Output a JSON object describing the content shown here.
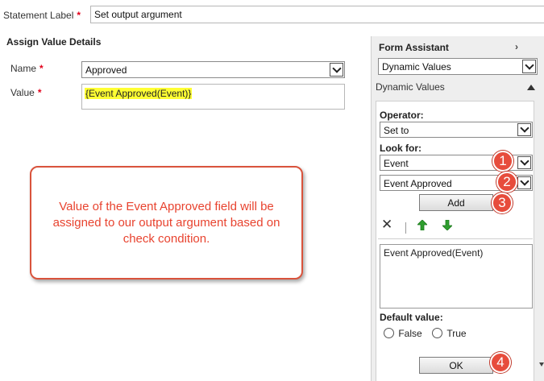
{
  "statement": {
    "label": "Statement Label",
    "value": "Set output argument"
  },
  "assign": {
    "title": "Assign Value Details",
    "name_label": "Name",
    "name_value": "Approved",
    "value_label": "Value",
    "value_text": "{Event Approved(Event)}"
  },
  "callout": {
    "text": "Value of the Event Approved field will be assigned to our output argument based on check condition."
  },
  "form_assistant": {
    "title": "Form Assistant",
    "dropdown_value": "Dynamic Values",
    "section_label": "Dynamic Values",
    "operator_label": "Operator:",
    "operator_value": "Set to",
    "look_for_label": "Look for:",
    "look_for_value": "Event",
    "field_value": "Event Approved",
    "add_label": "Add",
    "list_item": "Event Approved(Event)",
    "default_label": "Default value:",
    "false_label": "False",
    "true_label": "True",
    "ok_label": "OK"
  },
  "steps": [
    "1",
    "2",
    "3",
    "4"
  ],
  "colors": {
    "required": "#e2001a",
    "highlight": "#ffff33",
    "callout": "#e8432f",
    "badge": "#e74c3c",
    "green_arrow": "#2e9e2e"
  }
}
